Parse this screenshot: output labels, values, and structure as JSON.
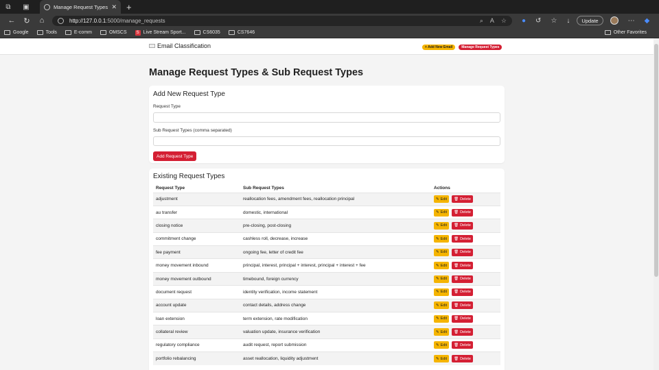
{
  "browser": {
    "tab_title": "Manage Request Types - Wells",
    "url_host": "http://127.0.0.1",
    "url_rest": ":5000/manage_requests",
    "update_label": "Update",
    "bookmarks": [
      "Google",
      "Tools",
      "E-comm",
      "OMSCS",
      "Live Stream Sport...",
      "CS6035",
      "CS7646"
    ],
    "other_favorites": "Other Favorites"
  },
  "navbar": {
    "brand": "Email Classification",
    "add_email": "+ Add New Email",
    "manage": "Manage Request Types"
  },
  "page": {
    "title": "Manage Request Types & Sub Request Types"
  },
  "form": {
    "heading": "Add New Request Type",
    "request_type_label": "Request Type",
    "sub_label": "Sub Request Types (comma separated)",
    "submit": "Add Request Type"
  },
  "existing": {
    "heading": "Existing Request Types",
    "columns": [
      "Request Type",
      "Sub Request Types",
      "Actions"
    ],
    "edit_label": "Edit",
    "delete_label": "Delete",
    "rows": [
      {
        "type": "adjustment",
        "subs": "reallocation fees, amendment fees, reallocation principal"
      },
      {
        "type": "au transfer",
        "subs": "domestic, international"
      },
      {
        "type": "closing notice",
        "subs": "pre-closing, post-closing"
      },
      {
        "type": "commitment change",
        "subs": "cashless roll, decrease, increase"
      },
      {
        "type": "fee payment",
        "subs": "ongoing fee, letter of credit fee"
      },
      {
        "type": "money movement inbound",
        "subs": "principal, interest, principal + interest, principal + interest + fee"
      },
      {
        "type": "money movement outbound",
        "subs": "timebound, foreign currency"
      },
      {
        "type": "document request",
        "subs": "identity verification, income statement"
      },
      {
        "type": "account update",
        "subs": "contact details, address change"
      },
      {
        "type": "loan extension",
        "subs": "term extension, rate modification"
      },
      {
        "type": "collateral review",
        "subs": "valuation update, insurance verification"
      },
      {
        "type": "regulatory compliance",
        "subs": "audit request, report submission"
      },
      {
        "type": "portfolio rebalancing",
        "subs": "asset reallocation, liquidity adjustment"
      }
    ]
  }
}
